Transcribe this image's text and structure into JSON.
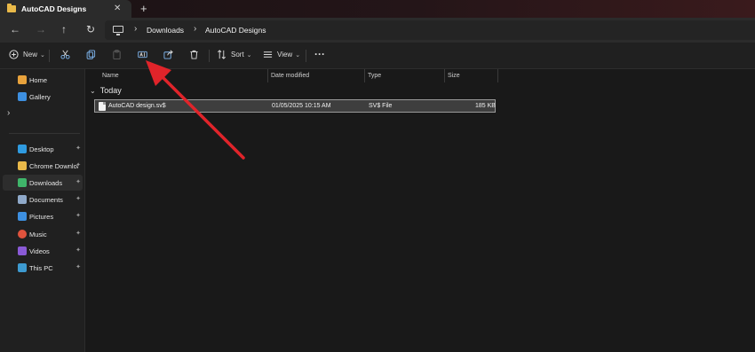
{
  "window": {
    "tab_title": "AutoCAD Designs",
    "tab_close": "✕",
    "new_tab": "+"
  },
  "nav": {
    "back": "←",
    "forward": "→",
    "up": "↑",
    "refresh": "↻"
  },
  "address": {
    "sep": "›",
    "crumbs": [
      "Downloads",
      "AutoCAD Designs"
    ]
  },
  "toolbar": {
    "new_label": "New",
    "sort_label": "Sort",
    "view_label": "View",
    "more": "···",
    "chevron": "⌄",
    "icons": [
      "new-icon",
      "cut-icon",
      "copy-icon",
      "paste-icon",
      "rename-icon",
      "share-icon",
      "delete-icon",
      "sort-icon",
      "view-icon",
      "more-icon"
    ]
  },
  "sidebar": {
    "expand": "›",
    "pin": "📌",
    "top_items": [
      {
        "label": "Home",
        "icon": "home-icon",
        "color": "#e8a23c"
      },
      {
        "label": "Gallery",
        "icon": "gallery-icon",
        "color": "#3d8fe0"
      }
    ],
    "items": [
      {
        "label": "Desktop",
        "icon": "desktop-icon",
        "color": "#2f9be0"
      },
      {
        "label": "Chrome Downloads",
        "icon": "folder-icon",
        "color": "#e9b949"
      },
      {
        "label": "Downloads",
        "icon": "download-icon",
        "color": "#3fb56a"
      },
      {
        "label": "Documents",
        "icon": "documents-icon",
        "color": "#8fa9c9"
      },
      {
        "label": "Pictures",
        "icon": "pictures-icon",
        "color": "#3d8fe0"
      },
      {
        "label": "Music",
        "icon": "music-icon",
        "color": "#e0533d"
      },
      {
        "label": "Videos",
        "icon": "videos-icon",
        "color": "#8a5ad6"
      },
      {
        "label": "This PC",
        "icon": "pc-icon",
        "color": "#3d9ad0"
      }
    ],
    "selected": "Downloads"
  },
  "file_list": {
    "columns": [
      "Name",
      "Date modified",
      "Type",
      "Size"
    ],
    "group": "Today",
    "group_chevron": "⌄",
    "rows": [
      {
        "name": "AutoCAD design.sv$",
        "date": "01/05/2025 10:15 AM",
        "type": "SV$ File",
        "size": "185 KB"
      }
    ]
  },
  "colors": {
    "annotation_arrow": "#e0242a",
    "selected_row_border": "#9a9a9a"
  }
}
